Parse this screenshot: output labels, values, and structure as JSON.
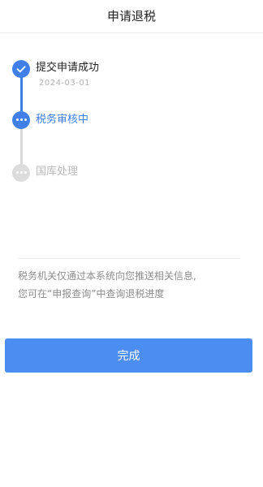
{
  "nav": {
    "title": "申请退税"
  },
  "steps": [
    {
      "label": "提交申请成功",
      "date": "2024-03-01",
      "status": "done",
      "icon": "check-icon"
    },
    {
      "label": "税务审核中",
      "status": "active",
      "icon": "ellipsis-icon"
    },
    {
      "label": "国库处理",
      "status": "pending",
      "icon": "ellipsis-icon"
    }
  ],
  "notice": {
    "line1": "税务机关仅通过本系统向您推送相关信息,",
    "line2": "您可在“申报查询”中查询退税进度"
  },
  "actions": {
    "done_label": "完成"
  },
  "colors": {
    "accent": "#3f7fe7",
    "button": "#4b8df0",
    "pending": "#dcdcdc",
    "muted_text": "#8c8c8c"
  }
}
